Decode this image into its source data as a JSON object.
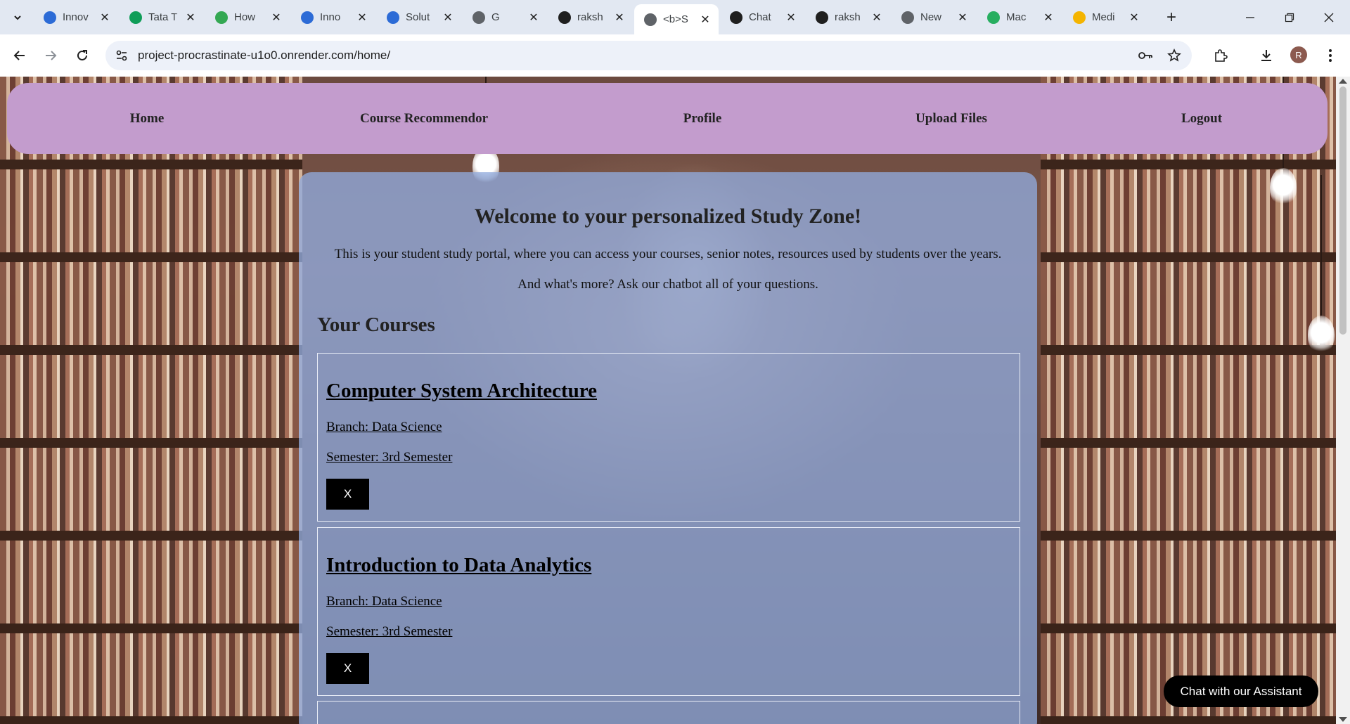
{
  "browser": {
    "tabs": [
      {
        "title": "Innov",
        "favicon": "chrome-blue-swirl-icon",
        "color": "#2c6bd6"
      },
      {
        "title": "Tata T",
        "favicon": "sheets-table-icon",
        "color": "#0f9d58"
      },
      {
        "title": "How",
        "favicon": "infinity-icon",
        "color": "#34a853"
      },
      {
        "title": "Inno",
        "favicon": "chrome-blue-swirl-icon",
        "color": "#2c6bd6"
      },
      {
        "title": "Solut",
        "favicon": "chrome-blue-swirl-icon",
        "color": "#2c6bd6"
      },
      {
        "title": "G",
        "favicon": "hand-icon",
        "color": "#5f6368"
      },
      {
        "title": "raksh",
        "favicon": "github-icon",
        "color": "#1f1f1f"
      },
      {
        "title": "<b>S",
        "favicon": "globe-icon",
        "color": "#5f6368",
        "active": true
      },
      {
        "title": "Chat",
        "favicon": "openai-icon",
        "color": "#1f1f1f"
      },
      {
        "title": "raksh",
        "favicon": "github-icon",
        "color": "#1f1f1f"
      },
      {
        "title": "New",
        "favicon": "chrome-icon",
        "color": "#5f6368"
      },
      {
        "title": "Mac",
        "favicon": "m-letter-icon",
        "color": "#27ae60"
      },
      {
        "title": "Medi",
        "favicon": "emoji-icon",
        "color": "#f4b400"
      }
    ],
    "url": "project-procrastinate-u1o0.onrender.com/home/",
    "profile_initial": "R"
  },
  "navbar": {
    "links": [
      "Home",
      "Course Recommendor",
      "Profile",
      "Upload Files",
      "Logout"
    ],
    "background": "#c39ccd"
  },
  "main": {
    "welcome": "Welcome to your personalized Study Zone!",
    "intro_line_1": "This is your student study portal, where you can access your courses, senior notes, resources used by students over the years.",
    "intro_line_2": "And what's more? Ask our chatbot all of your questions.",
    "courses_heading": "Your Courses",
    "courses": [
      {
        "title": "Computer System Architecture",
        "branch": "Branch: Data Science",
        "semester": "Semester: 3rd Semester",
        "remove_label": "X"
      },
      {
        "title": "Introduction to Data Analytics",
        "branch": "Branch: Data Science",
        "semester": "Semester: 3rd Semester",
        "remove_label": "X"
      }
    ]
  },
  "chat_button": "Chat with our Assistant"
}
